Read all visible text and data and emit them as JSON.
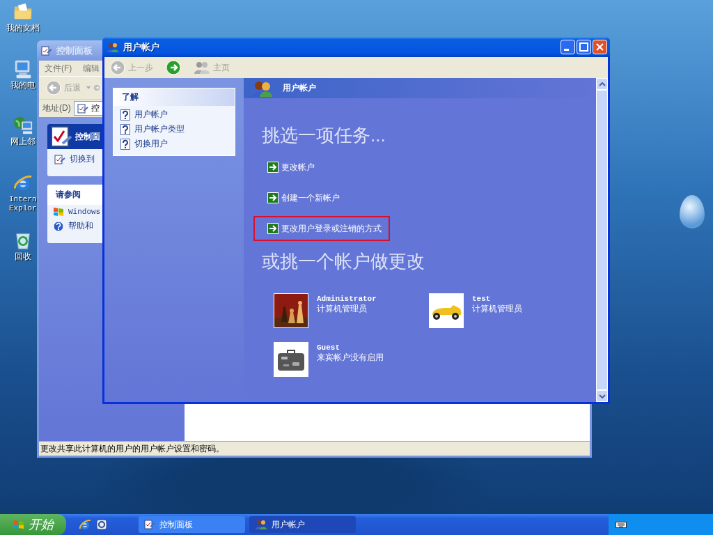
{
  "desktop_icons": [
    {
      "label": "我的文档"
    },
    {
      "label": "我的电"
    },
    {
      "label": "网上邻"
    },
    {
      "label": "Intern Explor"
    },
    {
      "label": "回收"
    }
  ],
  "control_panel_window": {
    "title": "控制面板",
    "menu": [
      "文件(F)",
      "编辑"
    ],
    "back_label": "后退",
    "address_label": "地址(D)",
    "address_value": "控",
    "panel_title": "控制面",
    "panel_link": "切换到",
    "see_also_title": "请参阅",
    "see_also": [
      "Windows",
      "帮助和"
    ],
    "status_text": "更改共享此计算机的用户的用户帐户设置和密码。"
  },
  "user_accounts_window": {
    "title": "用户帐户",
    "toolbar": [
      {
        "kind": "back",
        "label": "上一步",
        "disabled": true
      },
      {
        "kind": "forward",
        "disabled": false
      },
      {
        "kind": "home",
        "label": "主页",
        "disabled": true
      }
    ],
    "learn_title": "了解",
    "learn_links": [
      "用户帐户",
      "用户帐户类型",
      "切换用户"
    ],
    "header": "用户帐户",
    "task_heading": "挑选一项任务...",
    "tasks": [
      {
        "label": "更改帐户",
        "highlighted": false
      },
      {
        "label": "创建一个新帐户",
        "highlighted": false
      },
      {
        "label": "更改用户登录或注销的方式",
        "highlighted": true
      }
    ],
    "account_heading": "或挑一个帐户做更改",
    "accounts": [
      {
        "name": "Administrator",
        "role": "计算机管理员"
      },
      {
        "name": "test",
        "role": "计算机管理员"
      },
      {
        "name": "Guest",
        "role": "来宾帐户没有启用"
      }
    ]
  },
  "taskbar": {
    "start_label": "开始",
    "buttons": [
      {
        "label": "控制面板",
        "selected": false
      },
      {
        "label": "用户帐户",
        "selected": true
      }
    ]
  }
}
